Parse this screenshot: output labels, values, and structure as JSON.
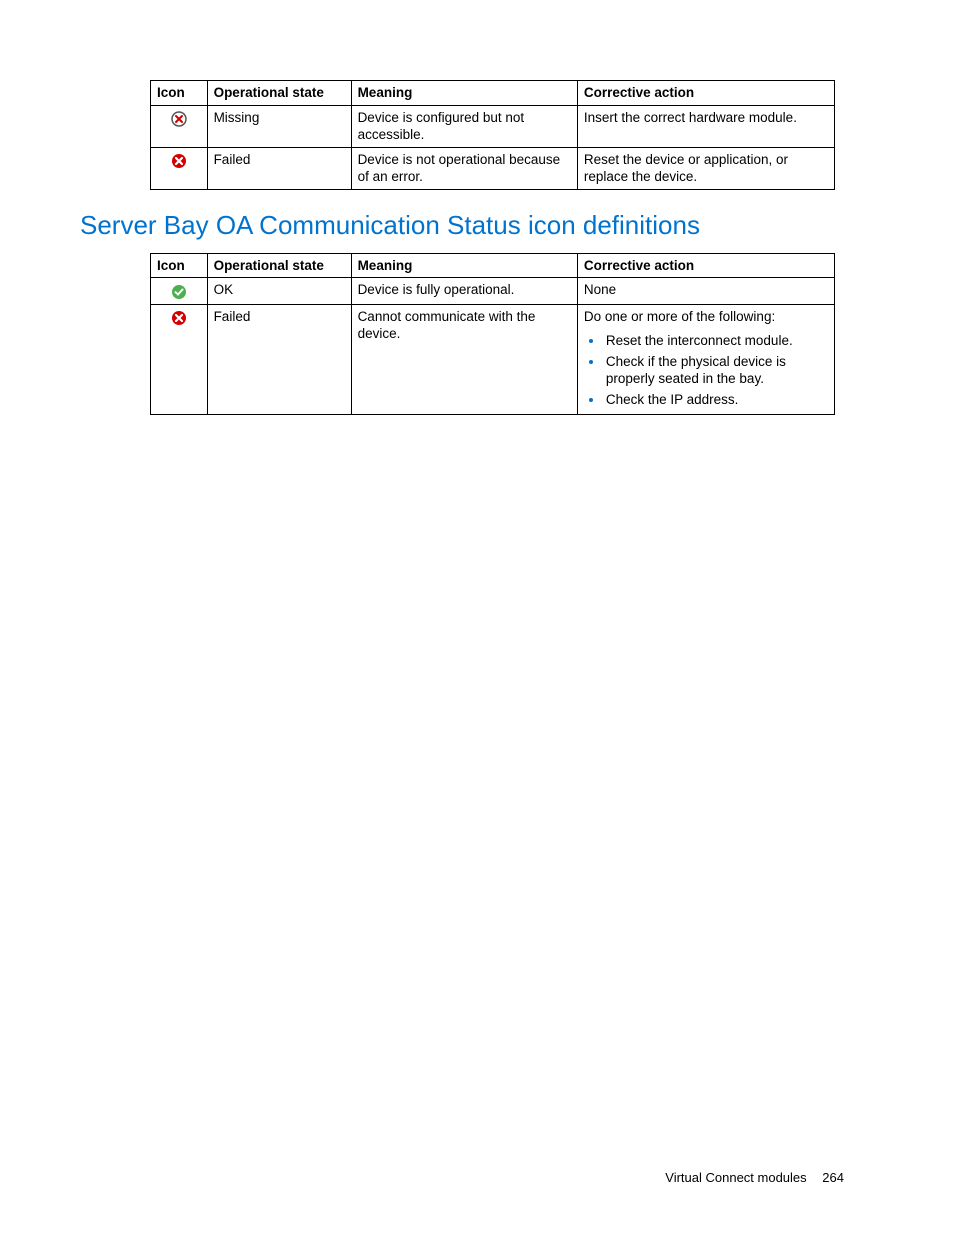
{
  "table1": {
    "headers": {
      "icon": "Icon",
      "state": "Operational state",
      "meaning": "Meaning",
      "action": "Corrective action"
    },
    "rows": [
      {
        "icon": "missing",
        "state": "Missing",
        "meaning": "Device is configured but not accessible.",
        "action": "Insert the correct hardware module."
      },
      {
        "icon": "failed",
        "state": "Failed",
        "meaning": "Device is not operational because of an error.",
        "action": "Reset the device or application, or replace the device."
      }
    ]
  },
  "section_heading": "Server Bay OA Communication Status icon definitions",
  "table2": {
    "headers": {
      "icon": "Icon",
      "state": "Operational state",
      "meaning": "Meaning",
      "action": "Corrective action"
    },
    "rows": [
      {
        "icon": "ok",
        "state": "OK",
        "meaning": "Device is fully operational.",
        "action_text": "None"
      },
      {
        "icon": "failed",
        "state": "Failed",
        "meaning": "Cannot communicate with the device.",
        "action_intro": "Do one or more of the following:",
        "action_items": [
          "Reset the interconnect module.",
          "Check if the physical device is properly seated in the bay.",
          "Check the IP address."
        ]
      }
    ]
  },
  "footer": {
    "section": "Virtual Connect modules",
    "page": "264"
  }
}
